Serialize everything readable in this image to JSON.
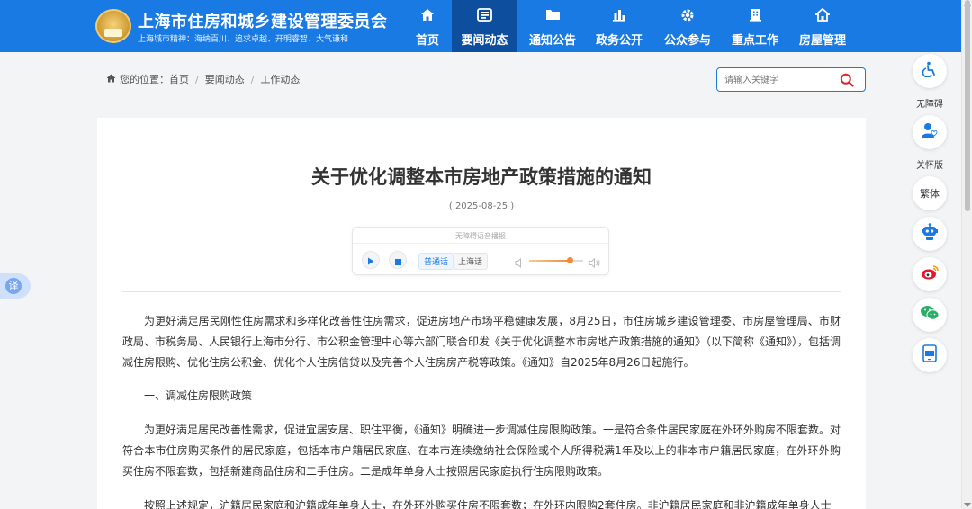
{
  "header": {
    "site_title": "上海市住房和城乡建设管理委员会",
    "motto": "上海城市精神：海纳百川、追求卓越、开明睿智、大气谦和",
    "nav": [
      {
        "label": "首页",
        "icon": "home-icon",
        "active": false
      },
      {
        "label": "要闻动态",
        "icon": "news-icon",
        "active": true
      },
      {
        "label": "通知公告",
        "icon": "folder-icon",
        "active": false
      },
      {
        "label": "政务公开",
        "icon": "chart-icon",
        "active": false
      },
      {
        "label": "公众参与",
        "icon": "gear-icon",
        "active": false
      },
      {
        "label": "重点工作",
        "icon": "building-icon",
        "active": false
      },
      {
        "label": "房屋管理",
        "icon": "house-icon",
        "active": false
      }
    ]
  },
  "breadcrumb": {
    "prefix": "您的位置：",
    "items": [
      "首页",
      "要闻动态",
      "工作动态"
    ]
  },
  "search": {
    "placeholder": "请输入关键字"
  },
  "sidebar": {
    "accessibility_label": "无障碍",
    "care_label": "关怀版",
    "traditional_label": "繁体"
  },
  "translate": {
    "label": "译"
  },
  "article": {
    "title": "关于优化调整本市房地产政策措施的通知",
    "date": "( 2025-08-25 )",
    "player": {
      "title": "无障碍语音播报",
      "lang_mandarin": "普通话",
      "lang_shanghainese": "上海话",
      "volume": 0.75
    },
    "paragraphs": [
      "为更好满足居民刚性住房需求和多样化改善性住房需求，促进房地产市场平稳健康发展，8月25日，市住房城乡建设管理委、市房屋管理局、市财政局、市税务局、人民银行上海市分行、市公积金管理中心等六部门联合印发《关于优化调整本市房地产政策措施的通知》（以下简称《通知》），包括调减住房限购、优化住房公积金、优化个人住房信贷以及完善个人住房房产税等政策。《通知》自2025年8月26日起施行。",
      "一、调减住房限购政策",
      "为更好满足居民改善性需求，促进宜居安居、职住平衡，《通知》明确进一步调减住房限购政策。一是符合条件居民家庭在外环外购房不限套数。对符合本市住房购买条件的居民家庭，包括本市户籍居民家庭、在本市连续缴纳社会保险或个人所得税满1年及以上的非本市户籍居民家庭，在外环外购买住房不限套数，包括新建商品住房和二手住房。二是成年单身人士按照居民家庭执行住房限购政策。",
      "按照上述规定，沪籍居民家庭和沪籍成年单身人士，在外环外购买住房不限套数；在外环内限购2套住房。非沪籍居民家庭和非沪籍成年单身人士"
    ]
  }
}
